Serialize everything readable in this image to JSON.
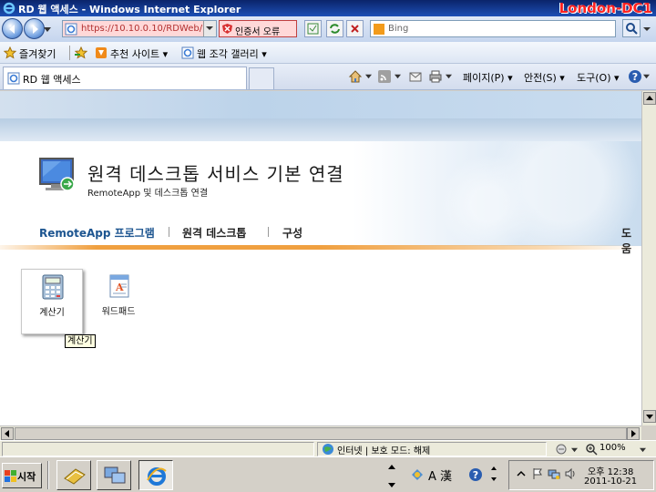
{
  "window": {
    "title": "RD 웹 액세스 - Windows Internet Explorer",
    "machine_label": "London-DC1",
    "machine_label_color": "#ff2020"
  },
  "address_bar": {
    "url": "https://10.10.0.10/RDWeb/",
    "certificate_error": "인증서 오류",
    "search_placeholder": "Bing"
  },
  "favorites_bar": {
    "favorites_label": "즐겨찾기",
    "suggested_sites": "추천 사이트 ▾",
    "web_slice_gallery": "웹 조각 갤러리 ▾"
  },
  "tab": {
    "label": "RD 웹 액세스"
  },
  "command_bar": {
    "page": "페이지(P) ▾",
    "safety": "안전(S) ▾",
    "tools": "도구(O) ▾"
  },
  "page": {
    "title": "원격 데스크톱 서비스 기본 연결",
    "subtitle": "RemoteApp 및 데스크톱 연결",
    "nav": {
      "remoteapp": "RemoteApp 프로그램",
      "remote_desktop": "원격 데스크톱",
      "configuration": "구성",
      "help": "도움"
    },
    "apps": [
      {
        "label": "계산기",
        "icon": "calculator-icon",
        "selected": true
      },
      {
        "label": "워드패드",
        "icon": "wordpad-icon",
        "selected": false
      }
    ],
    "tooltip": "계산기"
  },
  "status_bar": {
    "zone": "인터넷 | 보호 모드: 해제",
    "zoom": "100%"
  },
  "taskbar": {
    "start_label": "시작",
    "clock_time": "오후 12:38",
    "clock_date": "2011-10-21",
    "ime": "A 漢"
  },
  "colors": {
    "accent_blue": "#1d5590",
    "orange_line": "#f0a040",
    "titlebar": "#0a246a"
  }
}
